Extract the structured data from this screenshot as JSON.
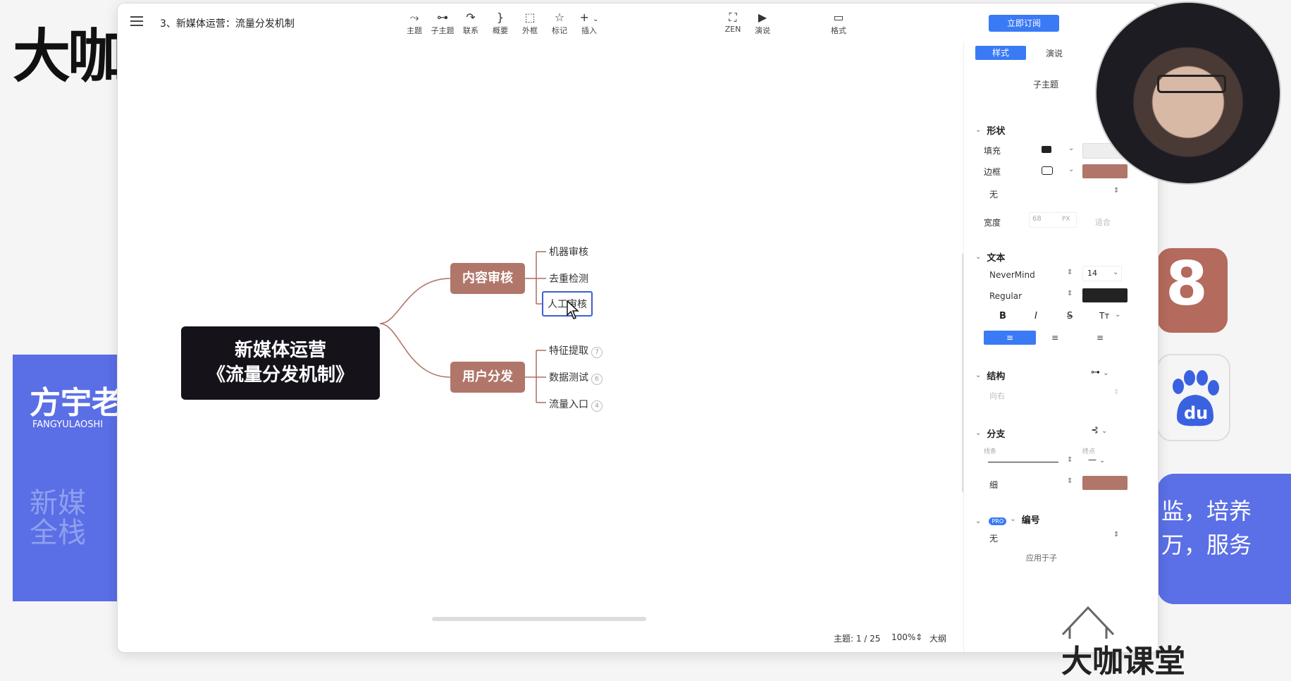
{
  "background": {
    "big_text": "大咖",
    "blue_card": {
      "name": "方宇老",
      "pinyin": "FANGYULAOSHI",
      "faded_lines": [
        "新媒",
        "全栈"
      ]
    },
    "promo_lines": [
      "监，培养",
      "万，服务"
    ],
    "watermark_text": "大咖课堂"
  },
  "window": {
    "doc_title": "3、新媒体运营：流量分发机制",
    "toolbar": [
      {
        "icon": "topic-icon",
        "glyph": "⤳",
        "label": "主题"
      },
      {
        "icon": "subtopic-icon",
        "glyph": "⊶",
        "label": "子主题"
      },
      {
        "icon": "relation-icon",
        "glyph": "↷",
        "label": "联系"
      },
      {
        "icon": "summary-icon",
        "glyph": "}",
        "label": "概要"
      },
      {
        "icon": "boundary-icon",
        "glyph": "⬚",
        "label": "外框"
      },
      {
        "icon": "marker-icon",
        "glyph": "☆",
        "label": "标记"
      },
      {
        "icon": "insert-icon",
        "glyph": "+",
        "label": "插入"
      }
    ],
    "toolbar_right": [
      {
        "icon": "zen-icon",
        "glyph": "⛶",
        "label": "ZEN"
      },
      {
        "icon": "present-icon",
        "glyph": "▶",
        "label": "演说"
      },
      {
        "icon": "format-icon",
        "glyph": "▭",
        "label": "格式"
      }
    ],
    "subscribe_label": "立即订阅"
  },
  "mindmap": {
    "root_line1": "新媒体运营",
    "root_line2": "《流量分发机制》",
    "branches": [
      {
        "label": "内容审核",
        "leaves": [
          "机器审核",
          "去重检测",
          "人工审核"
        ],
        "counts": []
      },
      {
        "label": "用户分发",
        "leaves": [
          "特征提取",
          "数据测试",
          "流量入口"
        ],
        "counts": [
          "7",
          "6",
          "4"
        ]
      }
    ],
    "selected_leaf": "人工审核"
  },
  "status_bar": {
    "topic": "主题: 1 / 25",
    "zoom": "100%",
    "outline": "大纲"
  },
  "panel": {
    "tab_style": "样式",
    "tab_speech": "演说",
    "subtopic_label": "子主题",
    "shape_section": "形状",
    "fill_label": "填充",
    "border_label": "边框",
    "border_value": "无",
    "width_label": "宽度",
    "width_value": "68",
    "width_unit": "PX",
    "width_fit": "适合",
    "text_section": "文本",
    "font_name": "NeverMind",
    "font_size": "14",
    "font_weight": "Regular",
    "bold": "B",
    "italic": "I",
    "strike": "S",
    "case": "Tт",
    "structure_section": "结构",
    "structure_value": "向右",
    "branch_section": "分支",
    "line_label": "线条",
    "end_label": "终点",
    "thin_label": "细",
    "numbering_section": "编号",
    "pro_badge": "PRO",
    "numbering_value": "无",
    "apply_text": "应用于子"
  },
  "colors": {
    "branch": "#b1766a",
    "root": "#15121a",
    "accent": "#3a7af5",
    "border_swatch": "#b1766a",
    "text_color_swatch": "#222222",
    "fill_swatch": "#eeeeee"
  }
}
